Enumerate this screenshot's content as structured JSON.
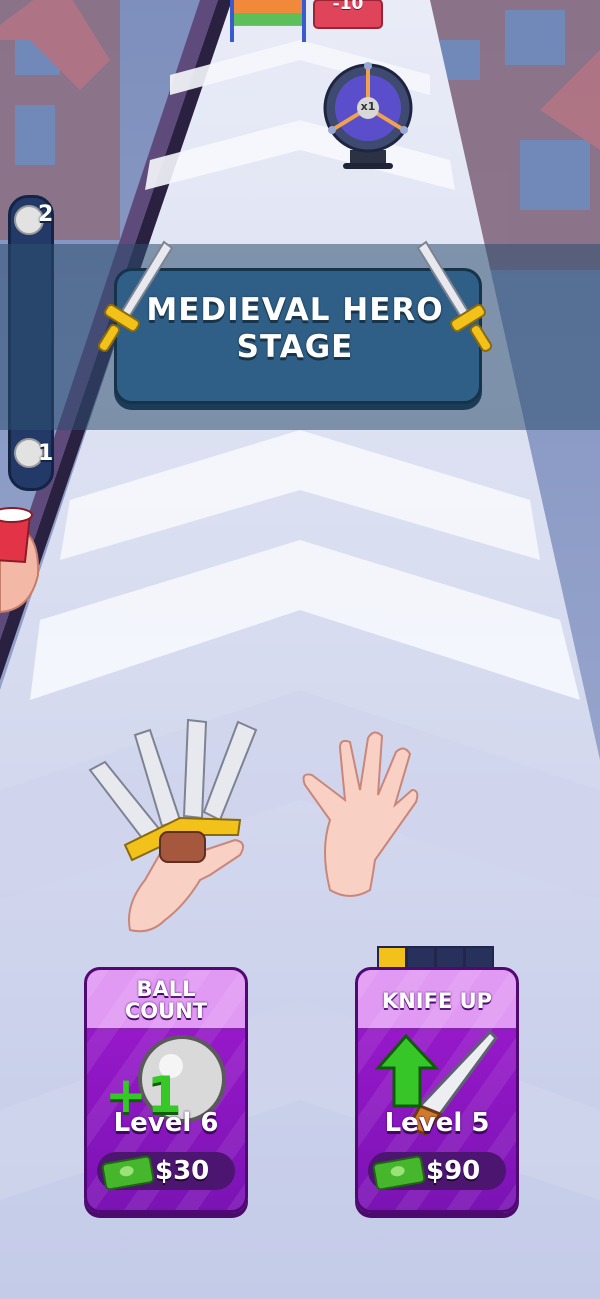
{
  "stage_banner": {
    "title": "MEDIEVAL HERO STAGE"
  },
  "top_sign": {
    "value": "-10"
  },
  "target": {
    "multiplier": "x1"
  },
  "ball_meter": {
    "top_value": "2",
    "bottom_value": "1"
  },
  "upgrades": [
    {
      "title": "BALL\nCOUNT",
      "badge": "+1",
      "level": "Level 6",
      "price": "$30"
    },
    {
      "title": "KNIFE UP",
      "level": "Level 5",
      "price": "$90",
      "progress_filled": 1,
      "progress_total": 4
    }
  ],
  "colors": {
    "card_purple": "#8a16c0",
    "card_header": "#e19af3",
    "banner_blue": "#2f5f86",
    "accent_yellow": "#f2c21a"
  }
}
